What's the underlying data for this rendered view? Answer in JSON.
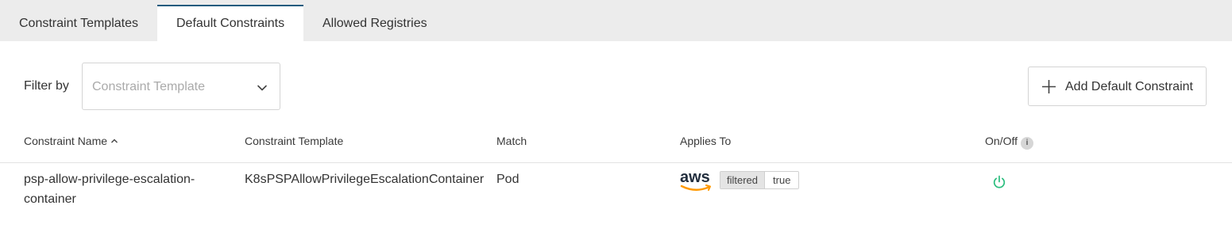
{
  "tabs": [
    {
      "label": "Constraint Templates",
      "active": false
    },
    {
      "label": "Default Constraints",
      "active": true
    },
    {
      "label": "Allowed Registries",
      "active": false
    }
  ],
  "filter": {
    "label": "Filter by",
    "placeholder": "Constraint Template",
    "icon": "chevron-down-icon"
  },
  "toolbar": {
    "add_label": "Add Default Constraint",
    "add_icon": "plus-icon"
  },
  "table": {
    "columns": [
      "Constraint Name",
      "Constraint Template",
      "Match",
      "Applies To",
      "On/Off"
    ],
    "sort_icon": "chevron-up-icon",
    "info_icon_text": "i",
    "rows": [
      {
        "name": "psp-allow-privilege-escalation-container",
        "template": "K8sPSPAllowPrivilegeEscalationContainer",
        "match": "Pod",
        "provider_logo": "aws",
        "label_key": "filtered",
        "label_value": "true",
        "enabled": true
      }
    ]
  },
  "colors": {
    "active_tab_border": "#1c5b7e",
    "power_on": "#2bbd7e",
    "aws_orange": "#ff9900",
    "aws_text": "#232f3e"
  }
}
